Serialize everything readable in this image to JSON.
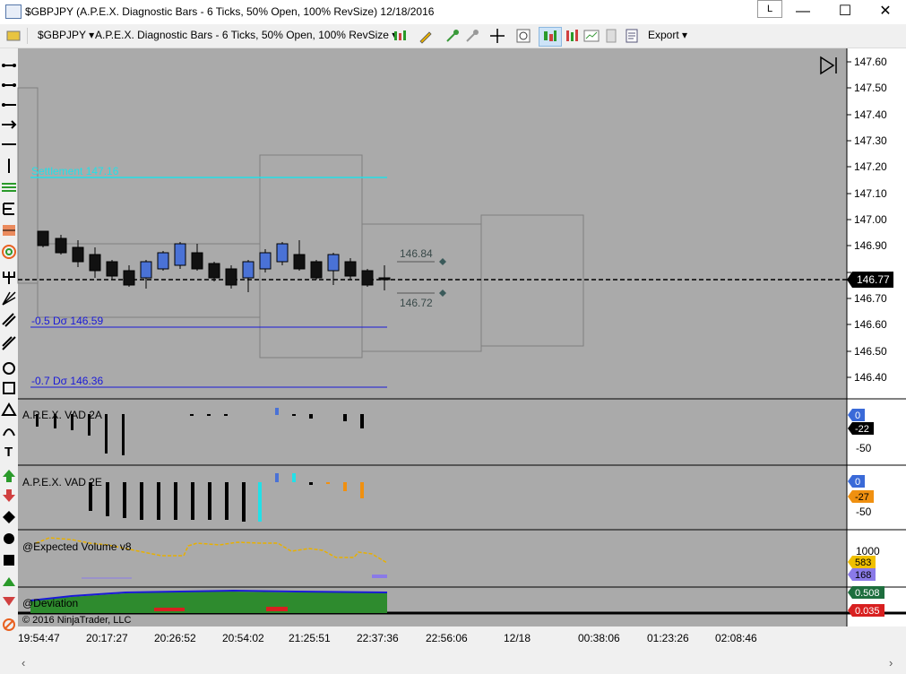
{
  "window": {
    "title": "$GBPJPY (A.P.E.X. Diagnostic Bars - 6 Ticks, 50% Open, 100% RevSize)  12/18/2016",
    "l_button": "L",
    "minimize": "—",
    "maximize": "☐",
    "close": "✕"
  },
  "toolbar": {
    "instrument": "$GBPJPY",
    "bar_type": "A.P.E.X. Diagnostic Bars - 6 Ticks, 50% Open, 100% RevSize",
    "export_label": "Export"
  },
  "chart": {
    "settlement_label": "Settlement 147.16",
    "dev_05_label": "-0.5 Dσ 146.59",
    "dev_07_label": "-0.7 Dσ 146.36",
    "level_upper": "146.84",
    "level_lower": "146.72",
    "last_price": "146.77",
    "copyright": "© 2016 NinjaTrader, LLC"
  },
  "price_axis": {
    "ticks": [
      "147.60",
      "147.50",
      "147.40",
      "147.30",
      "147.20",
      "147.10",
      "147.00",
      "146.90",
      "146.80",
      "146.70",
      "146.60",
      "146.50",
      "146.40"
    ]
  },
  "panels": {
    "vad2a": {
      "label": "A.P.E.X. VAD 2A",
      "axis_label": "-50",
      "marker_a": "0",
      "marker_b": "-22"
    },
    "vad2e": {
      "label": "A.P.E.X. VAD 2E",
      "axis_label": "-50",
      "marker_a": "0",
      "marker_b": "-27"
    },
    "volume": {
      "label": "@Expected Volume v8",
      "axis_label": "1000",
      "marker_a": "583",
      "marker_b": "168"
    },
    "deviation": {
      "label": "@Deviation",
      "marker_a": "0.508",
      "marker_b": "0.035"
    }
  },
  "time_axis": {
    "labels": [
      "19:54:47",
      "20:17:27",
      "20:26:52",
      "20:54:02",
      "21:25:51",
      "22:37:36",
      "22:56:06",
      "12/18",
      "00:38:06",
      "01:23:26",
      "02:08:46"
    ]
  },
  "colors": {
    "chart_bg": "#aaaaaa",
    "up_bar": "#4a72d6",
    "down_bar": "#111111",
    "settlement": "#22e0e8",
    "deviation_line": "#1a1ad8",
    "volume_line": "#e8b000",
    "deviation_fill": "#2e8b2e",
    "deviation_neg": "#d82020"
  }
}
